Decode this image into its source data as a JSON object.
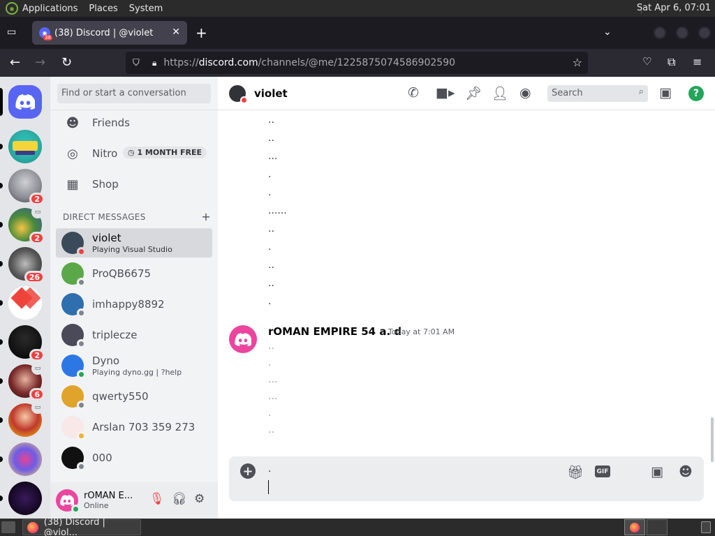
{
  "desktop": {
    "menus": [
      "Applications",
      "Places",
      "System"
    ],
    "clock": "Sat Apr  6, 07:01"
  },
  "browser": {
    "tab_title": "(38) Discord | @violet",
    "tab_badge": "38",
    "url_prefix": "https://",
    "url_host": "discord.com",
    "url_path": "/channels/@me/1225875074586902590"
  },
  "guilds": [
    {
      "name": "home",
      "badge": ""
    },
    {
      "name": "guild-1",
      "badge": ""
    },
    {
      "name": "guild-2",
      "badge": "2"
    },
    {
      "name": "guild-3",
      "badge": "2"
    },
    {
      "name": "guild-4",
      "badge": "26"
    },
    {
      "name": "guild-5",
      "badge": ""
    },
    {
      "name": "guild-6",
      "badge": "2"
    },
    {
      "name": "guild-7",
      "badge": "6"
    },
    {
      "name": "guild-8",
      "badge": ""
    },
    {
      "name": "guild-9",
      "badge": ""
    },
    {
      "name": "guild-10",
      "badge": ""
    }
  ],
  "dm_panel": {
    "search_placeholder": "Find or start a conversation",
    "nav": {
      "friends": "Friends",
      "nitro": "Nitro",
      "nitro_pill": "1 MONTH FREE",
      "shop": "Shop"
    },
    "header": "DIRECT MESSAGES",
    "items": [
      {
        "name": "violet",
        "sub": "Playing Visual Studio",
        "status": "dnd",
        "color": "#3b4a5a"
      },
      {
        "name": "ProQB6675",
        "sub": "",
        "status": "offline",
        "color": "#5aa84a"
      },
      {
        "name": "imhappy8892",
        "sub": "",
        "status": "offline",
        "color": "#2f6fae"
      },
      {
        "name": "triplecze",
        "sub": "",
        "status": "offline",
        "color": "#4a4a58"
      },
      {
        "name": "Dyno",
        "sub": "Playing dyno.gg | ?help",
        "status": "online",
        "color": "#2b78e4"
      },
      {
        "name": "qwerty550",
        "sub": "",
        "status": "offline",
        "color": "#e0a32b"
      },
      {
        "name": "Arslan 703 359 273",
        "sub": "",
        "status": "idle",
        "color": "#f8e8e8"
      },
      {
        "name": "000",
        "sub": "",
        "status": "offline",
        "color": "#111111"
      }
    ]
  },
  "user_panel": {
    "name": "rOMAN E...",
    "status": "Online"
  },
  "chat": {
    "recipient": "violet",
    "search_placeholder": "Search",
    "earlier_lines": [
      "..",
      "..",
      "...",
      ".",
      ".",
      "......",
      "..",
      ".",
      "..",
      "..",
      "."
    ],
    "author": "rOMAN EMPIRE 54 a. d",
    "timestamp": "Today at 7:01 AM",
    "pending_lines": [
      "..",
      ".",
      "...",
      "...",
      ".",
      ".."
    ],
    "composer_text": "."
  },
  "taskbar": {
    "window_title": "(38) Discord | @viol..."
  },
  "colors": {
    "blurple": "#5865f2",
    "pink_avatar": "#eb459e",
    "online": "#23a55a",
    "dnd": "#f23f43",
    "idle": "#f0b232"
  }
}
